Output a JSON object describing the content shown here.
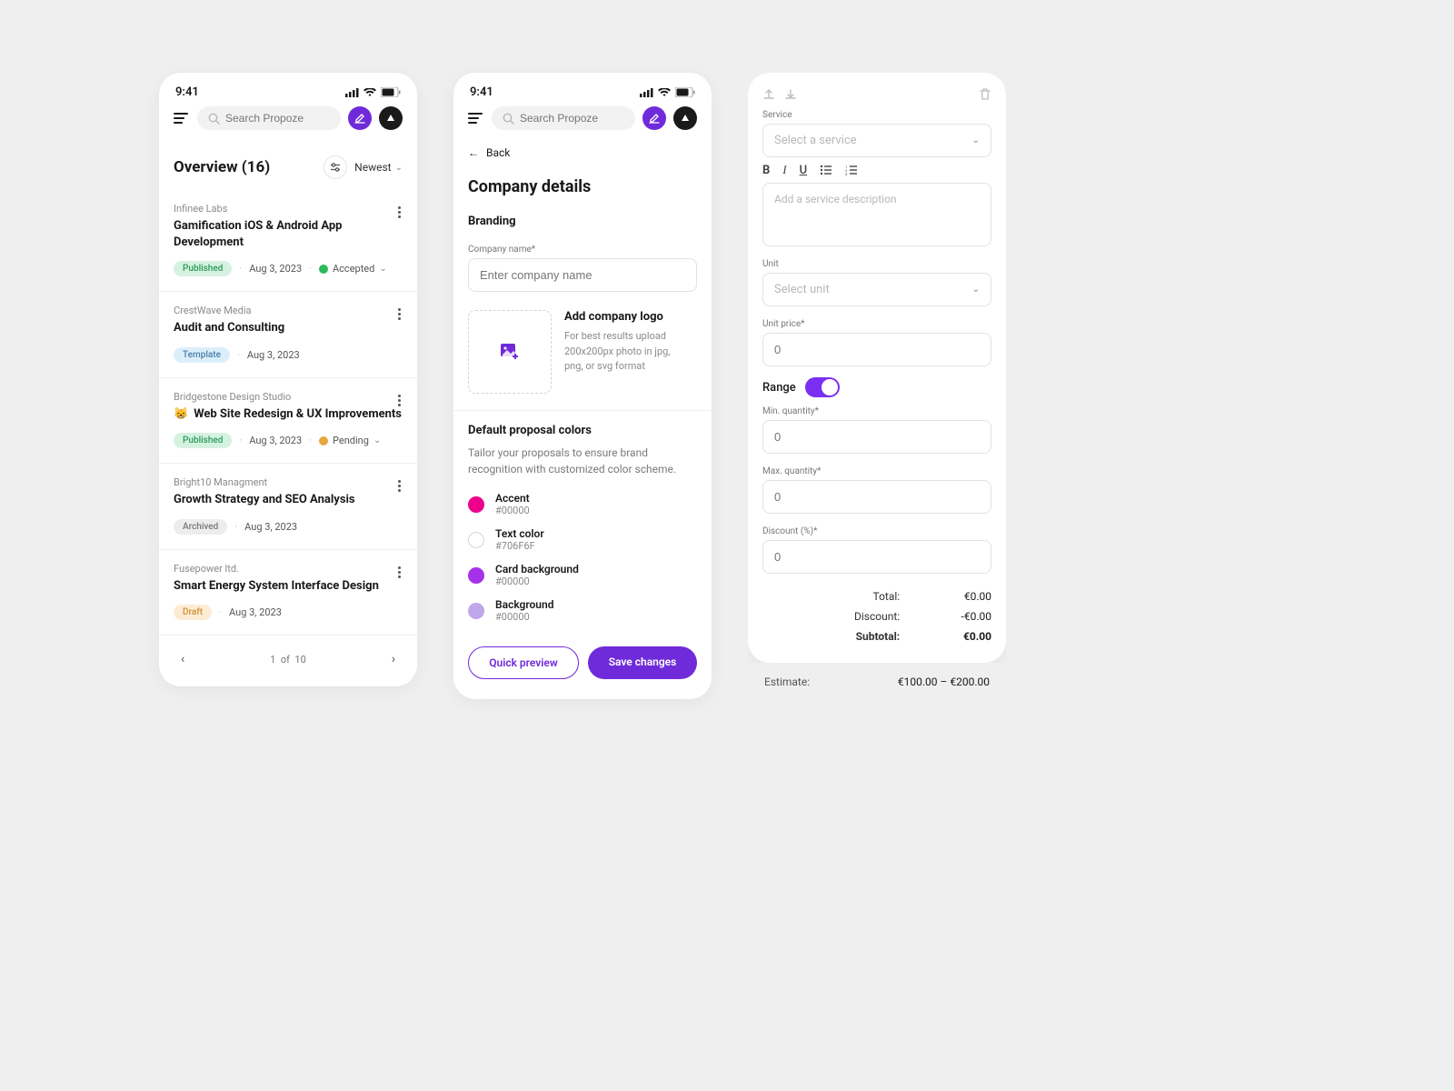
{
  "statusbar": {
    "time": "9:41"
  },
  "appbar": {
    "search_placeholder": "Search Propoze"
  },
  "overview": {
    "title": "Overview (16)",
    "sort": "Newest",
    "pager": {
      "page": "1",
      "of_label": "of",
      "total": "10"
    }
  },
  "items": [
    {
      "company": "Infinee Labs",
      "title": "Gamification iOS & Android App Development",
      "badge": "Published",
      "badge_tone": "green",
      "date": "Aug 3, 2023",
      "status": "Accepted",
      "status_tone": "ok"
    },
    {
      "company": "CrestWave Media",
      "title": "Audit and Consulting",
      "badge": "Template",
      "badge_tone": "blue",
      "date": "Aug 3, 2023"
    },
    {
      "company": "Bridgestone Design Studio",
      "title": "Web Site Redesign & UX Improvements",
      "icon": "😸",
      "badge": "Published",
      "badge_tone": "green",
      "date": "Aug 3, 2023",
      "status": "Pending",
      "status_tone": "pend"
    },
    {
      "company": "Bright10 Managment",
      "title": "Growth Strategy and SEO Analysis",
      "badge": "Archived",
      "badge_tone": "grey",
      "date": "Aug 3, 2023"
    },
    {
      "company": "Fusepower ltd.",
      "title": "Smart Energy System Interface Design",
      "badge": "Draft",
      "badge_tone": "orange",
      "date": "Aug 3, 2023"
    }
  ],
  "details": {
    "back": "Back",
    "h1": "Company details",
    "branding": "Branding",
    "company_label": "Company name*",
    "company_placeholder": "Enter company name",
    "logo_title": "Add company logo",
    "logo_hint": "For best results upload 200x200px photo in jpg, png, or svg format",
    "colors_h": "Default proposal colors",
    "colors_desc": "Tailor your proposals to ensure brand recognition with customized color scheme.",
    "colors": [
      {
        "name": "Accent",
        "hex": "#00000",
        "swatch": "#ec008c"
      },
      {
        "name": "Text color",
        "hex": "#706F6F",
        "swatch": "#ffffff",
        "border": true
      },
      {
        "name": "Card background",
        "hex": "#00000",
        "swatch": "#a531e8"
      },
      {
        "name": "Background",
        "hex": "#00000",
        "swatch": "#bfa7ea"
      }
    ],
    "preview_btn": "Quick preview",
    "save_btn": "Save changes"
  },
  "service": {
    "service_label": "Service",
    "service_placeholder": "Select a service",
    "desc_placeholder": "Add a service description",
    "unit_label": "Unit",
    "unit_placeholder": "Select unit",
    "unit_price_label": "Unit price*",
    "zero": "0",
    "range_label": "Range",
    "min_label": "Min. quantity*",
    "max_label": "Max. quantity*",
    "discount_label": "Discount (%)*",
    "totals": {
      "total_l": "Total:",
      "total_v": "€0.00",
      "discount_l": "Discount:",
      "discount_v": "-€0.00",
      "subtotal_l": "Subtotal:",
      "subtotal_v": "€0.00"
    },
    "estimate_l": "Estimate:",
    "estimate_v": "€100.00 – €200.00"
  }
}
